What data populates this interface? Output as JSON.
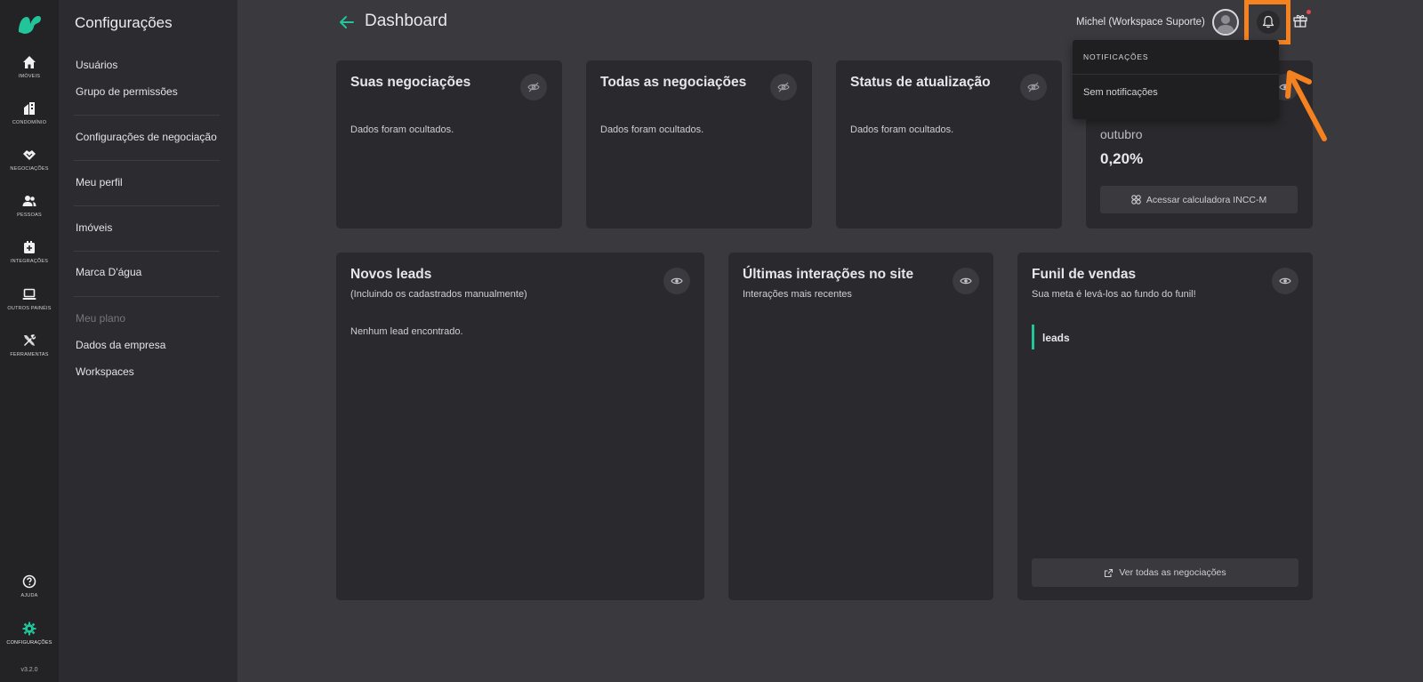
{
  "rail": {
    "items": [
      {
        "label": "IMÓVEIS",
        "icon": "home-icon"
      },
      {
        "label": "CONDOMÍNIO",
        "icon": "building-icon"
      },
      {
        "label": "NEGOCIAÇÕES",
        "icon": "handshake-icon"
      },
      {
        "label": "PESSOAS",
        "icon": "people-icon"
      },
      {
        "label": "INTEGRAÇÕES",
        "icon": "plugin-icon"
      },
      {
        "label": "OUTROS PAINÉIS",
        "icon": "laptop-icon"
      },
      {
        "label": "FERRAMENTAS",
        "icon": "tools-icon"
      }
    ],
    "help_label": "AJUDA",
    "settings_label": "CONFIGURAÇÕES",
    "version": "v3.2.0",
    "accent": "#22c49a"
  },
  "settings": {
    "title": "Configurações",
    "links": {
      "users": "Usuários",
      "permissions": "Grupo de permissões",
      "deal_settings": "Configurações de negociação",
      "profile": "Meu perfil",
      "properties": "Imóveis",
      "watermark": "Marca D'água",
      "plan": "Meu plano",
      "company": "Dados da empresa",
      "workspaces": "Workspaces"
    }
  },
  "header": {
    "title": "Dashboard",
    "user": "Michel (Workspace Suporte)"
  },
  "notifications": {
    "heading": "NOTIFICAÇÕES",
    "empty": "Sem notificações",
    "highlight_color": "#f5821f"
  },
  "cards": {
    "suas": {
      "title": "Suas negociações",
      "body": "Dados foram ocultados."
    },
    "todas": {
      "title": "Todas as negociações",
      "body": "Dados foram ocultados."
    },
    "status": {
      "title": "Status de atualização",
      "body": "Dados foram ocultados."
    },
    "incc": {
      "month": "outubro",
      "value": "0,20%",
      "button": "Acessar calculadora INCC-M"
    },
    "leads": {
      "title": "Novos leads",
      "subtitle": "(Incluindo os cadastrados manualmente)",
      "body": "Nenhum lead encontrado."
    },
    "interacoes": {
      "title": "Últimas interações no site",
      "subtitle": "Interações mais recentes"
    },
    "funil": {
      "title": "Funil de vendas",
      "subtitle": "Sua meta é levá-los ao fundo do funil!",
      "stage": "leads",
      "button": "Ver todas as negociações"
    }
  }
}
